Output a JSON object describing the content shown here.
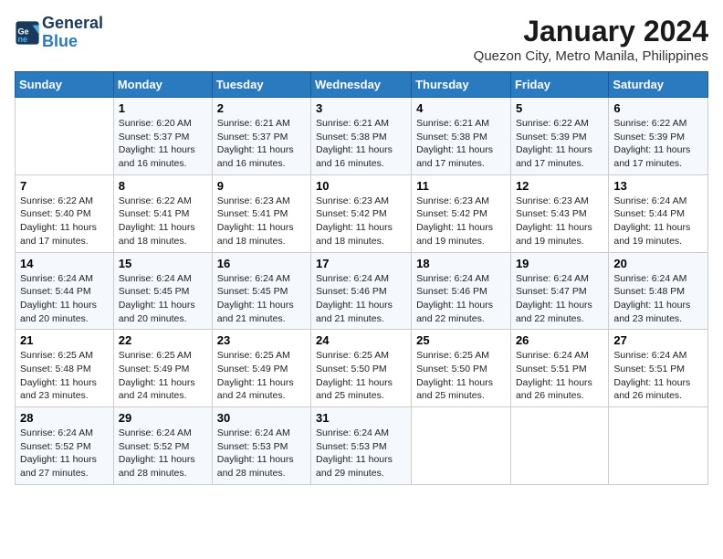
{
  "header": {
    "logo_text_general": "General",
    "logo_text_blue": "Blue",
    "month_title": "January 2024",
    "location": "Quezon City, Metro Manila, Philippines"
  },
  "weekdays": [
    "Sunday",
    "Monday",
    "Tuesday",
    "Wednesday",
    "Thursday",
    "Friday",
    "Saturday"
  ],
  "weeks": [
    [
      {
        "day": "",
        "sunrise": "",
        "sunset": "",
        "daylight": ""
      },
      {
        "day": "1",
        "sunrise": "Sunrise: 6:20 AM",
        "sunset": "Sunset: 5:37 PM",
        "daylight": "Daylight: 11 hours and 16 minutes."
      },
      {
        "day": "2",
        "sunrise": "Sunrise: 6:21 AM",
        "sunset": "Sunset: 5:37 PM",
        "daylight": "Daylight: 11 hours and 16 minutes."
      },
      {
        "day": "3",
        "sunrise": "Sunrise: 6:21 AM",
        "sunset": "Sunset: 5:38 PM",
        "daylight": "Daylight: 11 hours and 16 minutes."
      },
      {
        "day": "4",
        "sunrise": "Sunrise: 6:21 AM",
        "sunset": "Sunset: 5:38 PM",
        "daylight": "Daylight: 11 hours and 17 minutes."
      },
      {
        "day": "5",
        "sunrise": "Sunrise: 6:22 AM",
        "sunset": "Sunset: 5:39 PM",
        "daylight": "Daylight: 11 hours and 17 minutes."
      },
      {
        "day": "6",
        "sunrise": "Sunrise: 6:22 AM",
        "sunset": "Sunset: 5:39 PM",
        "daylight": "Daylight: 11 hours and 17 minutes."
      }
    ],
    [
      {
        "day": "7",
        "sunrise": "Sunrise: 6:22 AM",
        "sunset": "Sunset: 5:40 PM",
        "daylight": "Daylight: 11 hours and 17 minutes."
      },
      {
        "day": "8",
        "sunrise": "Sunrise: 6:22 AM",
        "sunset": "Sunset: 5:41 PM",
        "daylight": "Daylight: 11 hours and 18 minutes."
      },
      {
        "day": "9",
        "sunrise": "Sunrise: 6:23 AM",
        "sunset": "Sunset: 5:41 PM",
        "daylight": "Daylight: 11 hours and 18 minutes."
      },
      {
        "day": "10",
        "sunrise": "Sunrise: 6:23 AM",
        "sunset": "Sunset: 5:42 PM",
        "daylight": "Daylight: 11 hours and 18 minutes."
      },
      {
        "day": "11",
        "sunrise": "Sunrise: 6:23 AM",
        "sunset": "Sunset: 5:42 PM",
        "daylight": "Daylight: 11 hours and 19 minutes."
      },
      {
        "day": "12",
        "sunrise": "Sunrise: 6:23 AM",
        "sunset": "Sunset: 5:43 PM",
        "daylight": "Daylight: 11 hours and 19 minutes."
      },
      {
        "day": "13",
        "sunrise": "Sunrise: 6:24 AM",
        "sunset": "Sunset: 5:44 PM",
        "daylight": "Daylight: 11 hours and 19 minutes."
      }
    ],
    [
      {
        "day": "14",
        "sunrise": "Sunrise: 6:24 AM",
        "sunset": "Sunset: 5:44 PM",
        "daylight": "Daylight: 11 hours and 20 minutes."
      },
      {
        "day": "15",
        "sunrise": "Sunrise: 6:24 AM",
        "sunset": "Sunset: 5:45 PM",
        "daylight": "Daylight: 11 hours and 20 minutes."
      },
      {
        "day": "16",
        "sunrise": "Sunrise: 6:24 AM",
        "sunset": "Sunset: 5:45 PM",
        "daylight": "Daylight: 11 hours and 21 minutes."
      },
      {
        "day": "17",
        "sunrise": "Sunrise: 6:24 AM",
        "sunset": "Sunset: 5:46 PM",
        "daylight": "Daylight: 11 hours and 21 minutes."
      },
      {
        "day": "18",
        "sunrise": "Sunrise: 6:24 AM",
        "sunset": "Sunset: 5:46 PM",
        "daylight": "Daylight: 11 hours and 22 minutes."
      },
      {
        "day": "19",
        "sunrise": "Sunrise: 6:24 AM",
        "sunset": "Sunset: 5:47 PM",
        "daylight": "Daylight: 11 hours and 22 minutes."
      },
      {
        "day": "20",
        "sunrise": "Sunrise: 6:24 AM",
        "sunset": "Sunset: 5:48 PM",
        "daylight": "Daylight: 11 hours and 23 minutes."
      }
    ],
    [
      {
        "day": "21",
        "sunrise": "Sunrise: 6:25 AM",
        "sunset": "Sunset: 5:48 PM",
        "daylight": "Daylight: 11 hours and 23 minutes."
      },
      {
        "day": "22",
        "sunrise": "Sunrise: 6:25 AM",
        "sunset": "Sunset: 5:49 PM",
        "daylight": "Daylight: 11 hours and 24 minutes."
      },
      {
        "day": "23",
        "sunrise": "Sunrise: 6:25 AM",
        "sunset": "Sunset: 5:49 PM",
        "daylight": "Daylight: 11 hours and 24 minutes."
      },
      {
        "day": "24",
        "sunrise": "Sunrise: 6:25 AM",
        "sunset": "Sunset: 5:50 PM",
        "daylight": "Daylight: 11 hours and 25 minutes."
      },
      {
        "day": "25",
        "sunrise": "Sunrise: 6:25 AM",
        "sunset": "Sunset: 5:50 PM",
        "daylight": "Daylight: 11 hours and 25 minutes."
      },
      {
        "day": "26",
        "sunrise": "Sunrise: 6:24 AM",
        "sunset": "Sunset: 5:51 PM",
        "daylight": "Daylight: 11 hours and 26 minutes."
      },
      {
        "day": "27",
        "sunrise": "Sunrise: 6:24 AM",
        "sunset": "Sunset: 5:51 PM",
        "daylight": "Daylight: 11 hours and 26 minutes."
      }
    ],
    [
      {
        "day": "28",
        "sunrise": "Sunrise: 6:24 AM",
        "sunset": "Sunset: 5:52 PM",
        "daylight": "Daylight: 11 hours and 27 minutes."
      },
      {
        "day": "29",
        "sunrise": "Sunrise: 6:24 AM",
        "sunset": "Sunset: 5:52 PM",
        "daylight": "Daylight: 11 hours and 28 minutes."
      },
      {
        "day": "30",
        "sunrise": "Sunrise: 6:24 AM",
        "sunset": "Sunset: 5:53 PM",
        "daylight": "Daylight: 11 hours and 28 minutes."
      },
      {
        "day": "31",
        "sunrise": "Sunrise: 6:24 AM",
        "sunset": "Sunset: 5:53 PM",
        "daylight": "Daylight: 11 hours and 29 minutes."
      },
      {
        "day": "",
        "sunrise": "",
        "sunset": "",
        "daylight": ""
      },
      {
        "day": "",
        "sunrise": "",
        "sunset": "",
        "daylight": ""
      },
      {
        "day": "",
        "sunrise": "",
        "sunset": "",
        "daylight": ""
      }
    ]
  ]
}
